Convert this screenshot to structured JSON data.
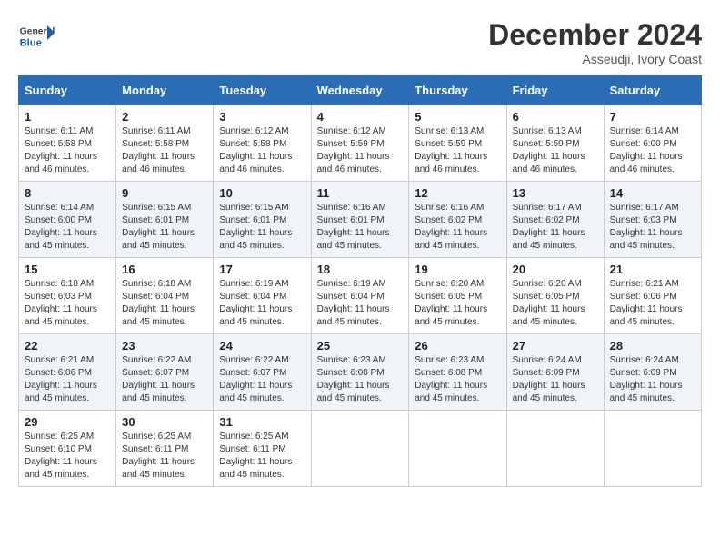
{
  "logo": {
    "general": "General",
    "blue": "Blue"
  },
  "header": {
    "month": "December 2024",
    "location": "Asseudji, Ivory Coast"
  },
  "weekdays": [
    "Sunday",
    "Monday",
    "Tuesday",
    "Wednesday",
    "Thursday",
    "Friday",
    "Saturday"
  ],
  "weeks": [
    [
      {
        "day": "1",
        "sunrise": "6:11 AM",
        "sunset": "5:58 PM",
        "daylight": "11 hours and 46 minutes."
      },
      {
        "day": "2",
        "sunrise": "6:11 AM",
        "sunset": "5:58 PM",
        "daylight": "11 hours and 46 minutes."
      },
      {
        "day": "3",
        "sunrise": "6:12 AM",
        "sunset": "5:58 PM",
        "daylight": "11 hours and 46 minutes."
      },
      {
        "day": "4",
        "sunrise": "6:12 AM",
        "sunset": "5:59 PM",
        "daylight": "11 hours and 46 minutes."
      },
      {
        "day": "5",
        "sunrise": "6:13 AM",
        "sunset": "5:59 PM",
        "daylight": "11 hours and 46 minutes."
      },
      {
        "day": "6",
        "sunrise": "6:13 AM",
        "sunset": "5:59 PM",
        "daylight": "11 hours and 46 minutes."
      },
      {
        "day": "7",
        "sunrise": "6:14 AM",
        "sunset": "6:00 PM",
        "daylight": "11 hours and 46 minutes."
      }
    ],
    [
      {
        "day": "8",
        "sunrise": "6:14 AM",
        "sunset": "6:00 PM",
        "daylight": "11 hours and 45 minutes."
      },
      {
        "day": "9",
        "sunrise": "6:15 AM",
        "sunset": "6:01 PM",
        "daylight": "11 hours and 45 minutes."
      },
      {
        "day": "10",
        "sunrise": "6:15 AM",
        "sunset": "6:01 PM",
        "daylight": "11 hours and 45 minutes."
      },
      {
        "day": "11",
        "sunrise": "6:16 AM",
        "sunset": "6:01 PM",
        "daylight": "11 hours and 45 minutes."
      },
      {
        "day": "12",
        "sunrise": "6:16 AM",
        "sunset": "6:02 PM",
        "daylight": "11 hours and 45 minutes."
      },
      {
        "day": "13",
        "sunrise": "6:17 AM",
        "sunset": "6:02 PM",
        "daylight": "11 hours and 45 minutes."
      },
      {
        "day": "14",
        "sunrise": "6:17 AM",
        "sunset": "6:03 PM",
        "daylight": "11 hours and 45 minutes."
      }
    ],
    [
      {
        "day": "15",
        "sunrise": "6:18 AM",
        "sunset": "6:03 PM",
        "daylight": "11 hours and 45 minutes."
      },
      {
        "day": "16",
        "sunrise": "6:18 AM",
        "sunset": "6:04 PM",
        "daylight": "11 hours and 45 minutes."
      },
      {
        "day": "17",
        "sunrise": "6:19 AM",
        "sunset": "6:04 PM",
        "daylight": "11 hours and 45 minutes."
      },
      {
        "day": "18",
        "sunrise": "6:19 AM",
        "sunset": "6:04 PM",
        "daylight": "11 hours and 45 minutes."
      },
      {
        "day": "19",
        "sunrise": "6:20 AM",
        "sunset": "6:05 PM",
        "daylight": "11 hours and 45 minutes."
      },
      {
        "day": "20",
        "sunrise": "6:20 AM",
        "sunset": "6:05 PM",
        "daylight": "11 hours and 45 minutes."
      },
      {
        "day": "21",
        "sunrise": "6:21 AM",
        "sunset": "6:06 PM",
        "daylight": "11 hours and 45 minutes."
      }
    ],
    [
      {
        "day": "22",
        "sunrise": "6:21 AM",
        "sunset": "6:06 PM",
        "daylight": "11 hours and 45 minutes."
      },
      {
        "day": "23",
        "sunrise": "6:22 AM",
        "sunset": "6:07 PM",
        "daylight": "11 hours and 45 minutes."
      },
      {
        "day": "24",
        "sunrise": "6:22 AM",
        "sunset": "6:07 PM",
        "daylight": "11 hours and 45 minutes."
      },
      {
        "day": "25",
        "sunrise": "6:23 AM",
        "sunset": "6:08 PM",
        "daylight": "11 hours and 45 minutes."
      },
      {
        "day": "26",
        "sunrise": "6:23 AM",
        "sunset": "6:08 PM",
        "daylight": "11 hours and 45 minutes."
      },
      {
        "day": "27",
        "sunrise": "6:24 AM",
        "sunset": "6:09 PM",
        "daylight": "11 hours and 45 minutes."
      },
      {
        "day": "28",
        "sunrise": "6:24 AM",
        "sunset": "6:09 PM",
        "daylight": "11 hours and 45 minutes."
      }
    ],
    [
      {
        "day": "29",
        "sunrise": "6:25 AM",
        "sunset": "6:10 PM",
        "daylight": "11 hours and 45 minutes."
      },
      {
        "day": "30",
        "sunrise": "6:25 AM",
        "sunset": "6:11 PM",
        "daylight": "11 hours and 45 minutes."
      },
      {
        "day": "31",
        "sunrise": "6:25 AM",
        "sunset": "6:11 PM",
        "daylight": "11 hours and 45 minutes."
      },
      null,
      null,
      null,
      null
    ]
  ]
}
